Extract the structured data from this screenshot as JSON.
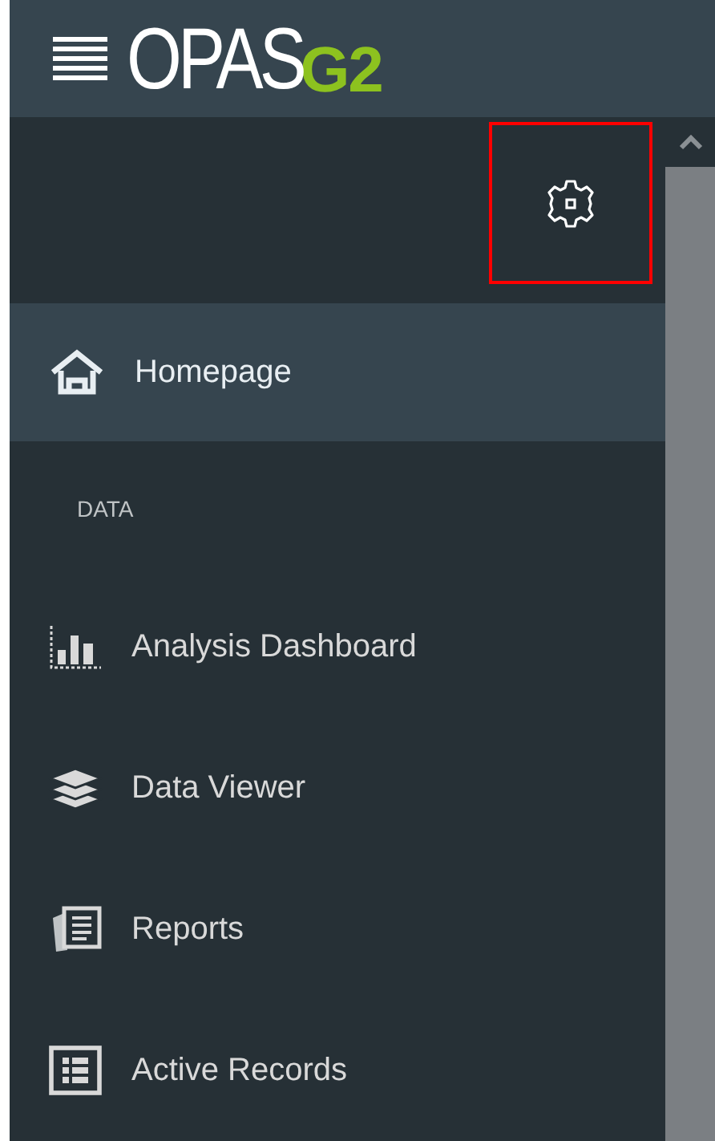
{
  "header": {
    "logo": {
      "text": "OPAS",
      "accent": "G2"
    }
  },
  "settings": {
    "highlighted": true
  },
  "nav": [
    {
      "kind": "item",
      "label": "Homepage",
      "selected": true
    },
    {
      "kind": "heading",
      "label": "DATA"
    },
    {
      "kind": "item",
      "label": "Analysis Dashboard",
      "selected": false
    },
    {
      "kind": "item",
      "label": "Data Viewer",
      "selected": false
    },
    {
      "kind": "item",
      "label": "Reports",
      "selected": false
    },
    {
      "kind": "item",
      "label": "Active Records",
      "selected": false
    }
  ]
}
